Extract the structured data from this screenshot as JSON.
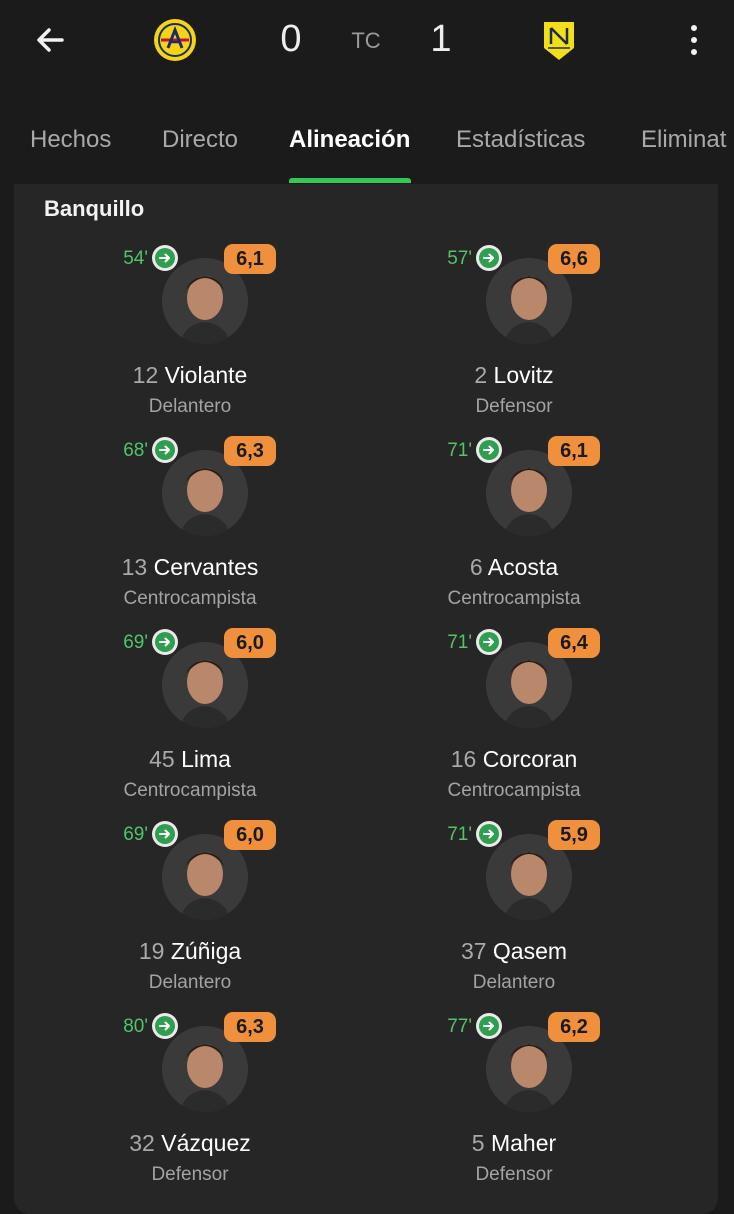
{
  "header": {
    "score_home": "0",
    "score_away": "1",
    "status": "TC",
    "icons": {
      "back": "arrow-left-icon",
      "more": "more-vertical-icon"
    },
    "home_logo_color": "#f5d416",
    "away_logo_color": "#f2df1a"
  },
  "tabs": [
    {
      "label": "Hechos"
    },
    {
      "label": "Directo"
    },
    {
      "label": "Alineación",
      "active": true
    },
    {
      "label": "Estadísticas"
    },
    {
      "label": "Eliminat"
    }
  ],
  "bench": {
    "title": "Banquillo",
    "home": [
      {
        "minute": "54'",
        "rating": "6,1",
        "number": "12",
        "name": "Violante",
        "position": "Delantero"
      },
      {
        "minute": "68'",
        "rating": "6,3",
        "number": "13",
        "name": "Cervantes",
        "position": "Centrocampista"
      },
      {
        "minute": "69'",
        "rating": "6,0",
        "number": "45",
        "name": "Lima",
        "position": "Centrocampista"
      },
      {
        "minute": "69'",
        "rating": "6,0",
        "number": "19",
        "name": "Zúñiga",
        "position": "Delantero"
      },
      {
        "minute": "80'",
        "rating": "6,3",
        "number": "32",
        "name": "Vázquez",
        "position": "Defensor"
      }
    ],
    "away": [
      {
        "minute": "57'",
        "rating": "6,6",
        "number": "2",
        "name": "Lovitz",
        "position": "Defensor"
      },
      {
        "minute": "71'",
        "rating": "6,1",
        "number": "6",
        "name": "Acosta",
        "position": "Centrocampista"
      },
      {
        "minute": "71'",
        "rating": "6,4",
        "number": "16",
        "name": "Corcoran",
        "position": "Centrocampista"
      },
      {
        "minute": "71'",
        "rating": "5,9",
        "number": "37",
        "name": "Qasem",
        "position": "Delantero"
      },
      {
        "minute": "77'",
        "rating": "6,2",
        "number": "5",
        "name": "Maher",
        "position": "Defensor"
      }
    ]
  },
  "colors": {
    "accent": "#34c759",
    "rating_bg": "#f0903c",
    "sub_minute": "#4fc46a"
  }
}
